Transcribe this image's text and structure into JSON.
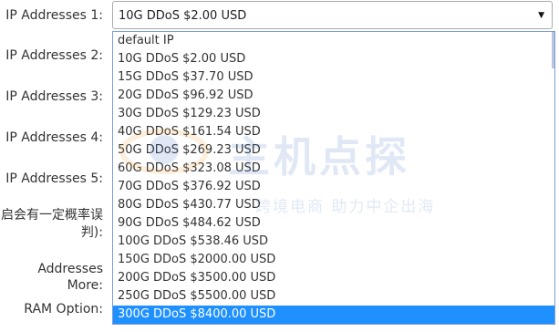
{
  "form": {
    "labels": [
      {
        "text": "IP Addresses 1:"
      },
      {
        "text": "IP Addresses 2:"
      },
      {
        "text": "IP Addresses 3:"
      },
      {
        "text": "IP Addresses 4:"
      },
      {
        "text": "IP Addresses 5:"
      },
      {
        "text": "启会有一定概率误"
      },
      {
        "text": "判):"
      },
      {
        "text": "Addresses More:"
      },
      {
        "text": "RAM Option:"
      }
    ]
  },
  "select": {
    "value": "10G DDoS $2.00 USD",
    "arrow_icon": "dropdown-arrow-icon"
  },
  "dropdown": {
    "selected_index": 15,
    "options": [
      "default IP",
      "10G DDoS $2.00 USD",
      "15G DDoS $37.70 USD",
      "20G DDoS $96.92 USD",
      "30G DDoS $129.23 USD",
      "40G DDoS $161.54 USD",
      "50G DDoS $269.23 USD",
      "60G DDoS $323.08 USD",
      "70G DDoS $376.92 USD",
      "80G DDoS $430.77 USD",
      "90G DDoS $484.62 USD",
      "100G DDoS $538.46 USD",
      "150G DDoS $2000.00 USD",
      "200G DDoS $3500.00 USD",
      "250G DDoS $5500.00 USD",
      "300G DDoS $8400.00 USD"
    ]
  },
  "watermark": {
    "main_text": "主机点探",
    "sub_text": "跨境电商 助力中企出海"
  },
  "colors": {
    "selected_bg": "#1e90ff",
    "dropdown_border": "#7a9cd3",
    "watermark": "#4a78c8"
  }
}
